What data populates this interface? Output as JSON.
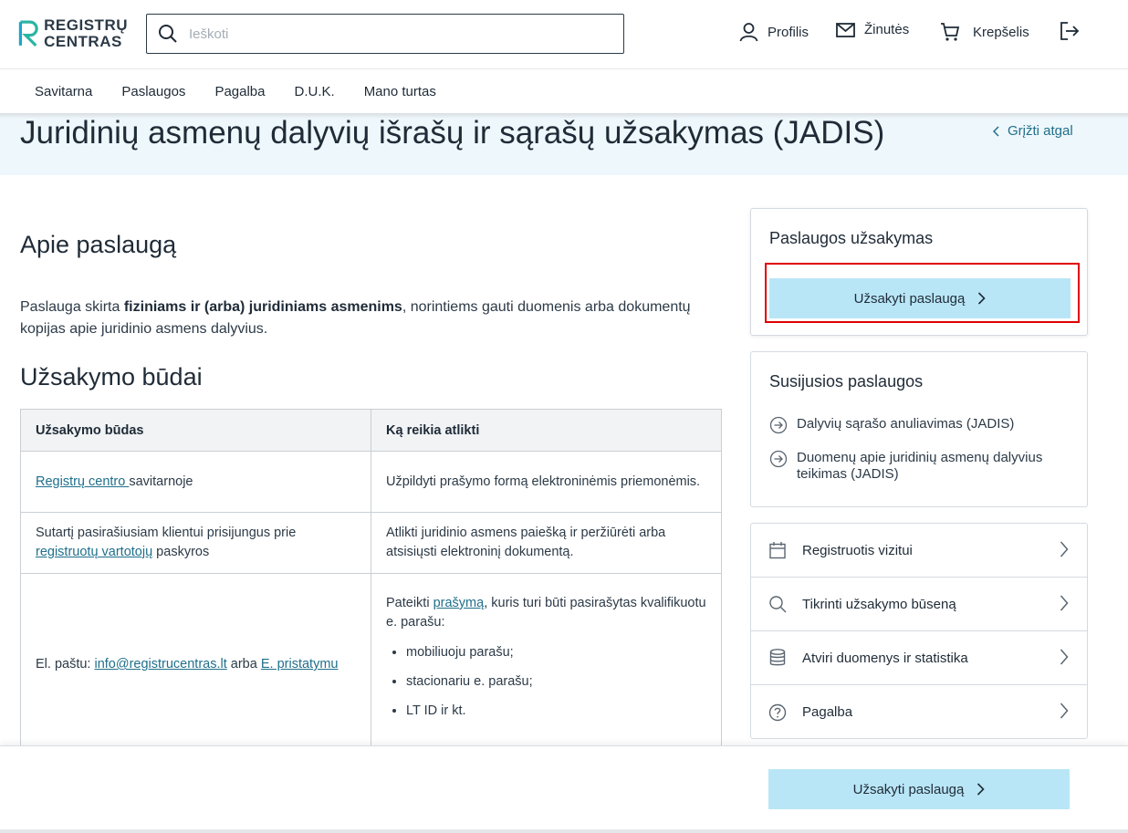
{
  "header": {
    "logo_line1": "REGISTRŲ",
    "logo_line2": "CENTRAS",
    "search_placeholder": "Ieškoti",
    "profile_label": "Profilis",
    "messages_label": "Žinutės",
    "cart_label": "Krepšelis"
  },
  "nav": {
    "items": [
      "Savitarna",
      "Paslaugos",
      "Pagalba",
      "D.U.K.",
      "Mano turtas"
    ]
  },
  "page": {
    "title": "Juridinių asmenų dalyvių išrašų ir sąrašų užsakymas (JADIS)",
    "back_label": "Grįžti atgal"
  },
  "about": {
    "heading": "Apie paslaugą",
    "text_before": "Paslauga skirta ",
    "text_bold": "fiziniams ir (arba) juridiniams asmenims",
    "text_after": ", norintiems gauti duomenis arba dokumentų kopijas apie juridinio asmens dalyvius."
  },
  "methods": {
    "heading": "Užsakymo būdai",
    "col1": "Užsakymo būdas",
    "col2": "Ką reikia atlikti",
    "row1": {
      "link": "Registrų centro ",
      "text": "savitarnoje",
      "action": "Užpildyti prašymo formą elektroninėmis priemonėmis."
    },
    "row2": {
      "text_before": "Sutartį pasirašiusiam klientui prisijungus prie ",
      "link": "registruotų vartotojų",
      "text_after": " paskyros",
      "action": "Atlikti juridinio asmens paiešką ir peržiūrėti arba atsisiųsti elektroninį dokumentą."
    },
    "row3": {
      "text_before": "El. paštu: ",
      "email_link": "info@registrucentras.lt",
      "text_mid": " arba ",
      "e_link": "E. pristatymu",
      "action_before": "Pateikti ",
      "action_link": "prašymą",
      "action_after": ", kuris turi būti pasirašytas kvalifikuotu e. parašu:",
      "bullets": [
        "mobiliuoju parašu;",
        "stacionariu e. parašu;",
        "LT ID ir kt."
      ]
    }
  },
  "order_card": {
    "title": "Paslaugos užsakymas",
    "button_label": "Užsakyti paslaugą"
  },
  "related_card": {
    "title": "Susijusios paslaugos",
    "items": [
      "Dalyvių sąrašo anuliavimas (JADIS)",
      "Duomenų apie juridinių asmenų dalyvius teikimas (JADIS)"
    ]
  },
  "quick_links": {
    "items": [
      "Registruotis vizitui",
      "Tikrinti užsakymo būseną",
      "Atviri duomenys ir statistika",
      "Pagalba"
    ]
  },
  "footer": {
    "button_label": "Užsakyti paslaugą"
  }
}
